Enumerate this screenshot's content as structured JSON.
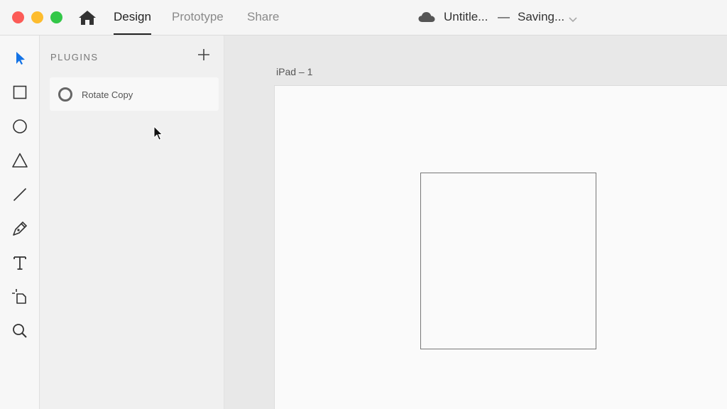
{
  "window": {
    "tabs": [
      {
        "label": "Design",
        "active": true
      },
      {
        "label": "Prototype",
        "active": false
      },
      {
        "label": "Share",
        "active": false
      }
    ],
    "document_title": "Untitle...",
    "separator": "—",
    "status": "Saving..."
  },
  "toolbar": {
    "tools": [
      "select-icon",
      "rectangle-icon",
      "ellipse-icon",
      "polygon-icon",
      "line-icon",
      "pen-icon",
      "text-icon",
      "artboard-icon",
      "zoom-icon"
    ],
    "active_tool": "select-icon",
    "accent": "#1473e6"
  },
  "plugins_panel": {
    "header": "PLUGINS",
    "items": [
      {
        "label": "Rotate Copy"
      }
    ]
  },
  "canvas": {
    "artboard_label": "iPad – 1"
  },
  "colors": {
    "close": "#fc5b57",
    "minimize": "#fdbc2e",
    "maximize": "#33c748"
  }
}
